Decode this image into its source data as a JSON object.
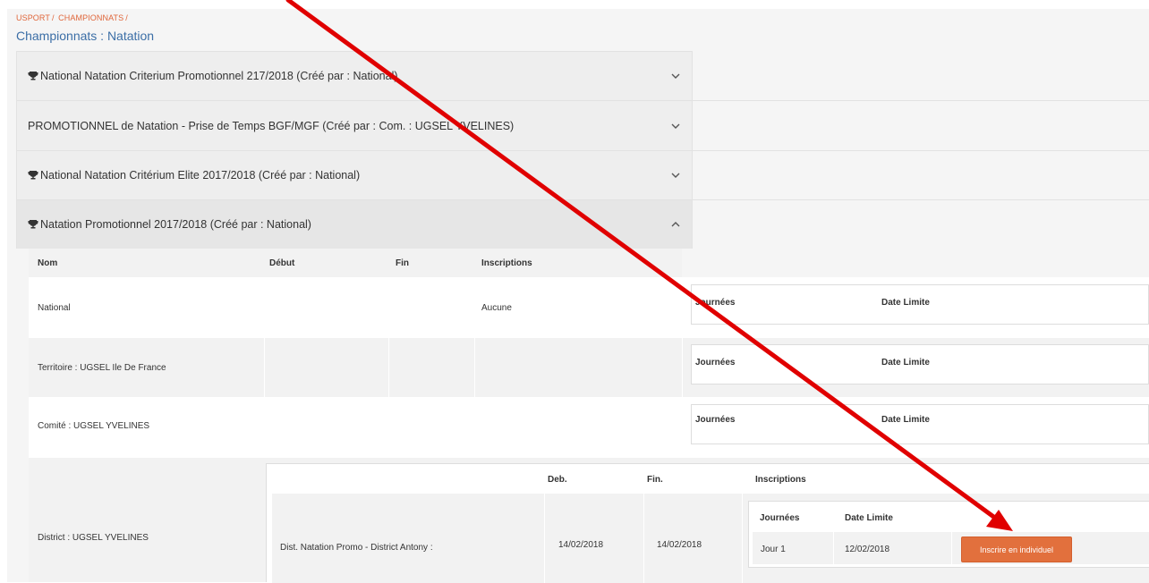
{
  "breadcrumb": {
    "items": [
      "USPORT",
      "/",
      "CHAMPIONNATS",
      "/"
    ]
  },
  "page_title": "Championnats : Natation",
  "accordions": [
    {
      "title": "National Natation Criterium Promotionnel 217/2018 (Créé par : National)",
      "trophy": true,
      "open": false
    },
    {
      "title": "PROMOTIONNEL de Natation - Prise de Temps BGF/MGF (Créé par : Com. : UGSEL YVELINES)",
      "trophy": false,
      "open": false
    },
    {
      "title": "National Natation Critérium Elite 2017/2018 (Créé par : National)",
      "trophy": true,
      "open": false
    },
    {
      "title": "Natation Promotionnel 2017/2018 (Créé par : National)",
      "trophy": true,
      "open": true
    }
  ],
  "table": {
    "headers": {
      "nom": "Nom",
      "debut": "Début",
      "fin": "Fin",
      "inscriptions": "Inscriptions"
    },
    "rows": [
      {
        "nom": "National",
        "inscriptions": "Aucune",
        "journees_label": "Journées",
        "date_limite_label": "Date Limite"
      },
      {
        "nom": "Territoire : UGSEL Ile De France",
        "journees_label": "Journées",
        "date_limite_label": "Date Limite"
      },
      {
        "nom": "Comité : UGSEL YVELINES",
        "journees_label": "Journées",
        "date_limite_label": "Date Limite"
      },
      {
        "nom": "District : UGSEL YVELINES"
      }
    ],
    "district": {
      "headers": {
        "deb": "Deb.",
        "fin": "Fin.",
        "inscriptions": "Inscriptions"
      },
      "event": {
        "name": "Dist. Natation Promo - District Antony :",
        "deb": "14/02/2018",
        "fin": "14/02/2018"
      },
      "inscriptions": {
        "headers": {
          "journees": "Journées",
          "date_limite": "Date Limite"
        },
        "jour": "Jour 1",
        "date_limite": "12/02/2018",
        "button": "Inscrire en individuel"
      }
    }
  },
  "colors": {
    "accent": "#e2703d",
    "title": "#3b6ea6",
    "breadcrumb": "#e0663a",
    "annotation_arrow": "#e00000"
  }
}
